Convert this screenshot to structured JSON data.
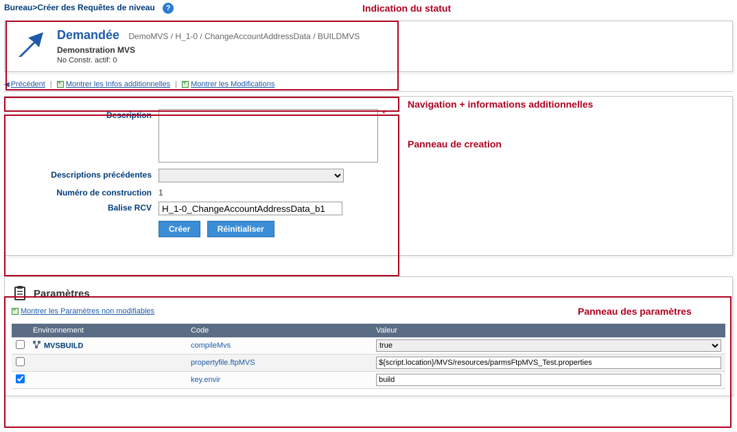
{
  "breadcrumb": {
    "part1": "Bureau",
    "part2": "Créer des Requêtes de niveau"
  },
  "annotations": {
    "status": "Indication du statut",
    "nav": "Navigation + informations additionnelles",
    "creation": "Panneau de creation",
    "params": "Panneau des paramètres"
  },
  "status": {
    "title": "Demandée",
    "path": "DemoMVS / H_1-0 / ChangeAccountAddressData / BUILDMVS",
    "sub": "Demonstration MVS",
    "constr_label": "No Constr. actif:",
    "constr_value": "0"
  },
  "nav": {
    "prev": "Précédent",
    "info": "Montrer les Infos additionnelles",
    "modif": "Montrer les Modifications"
  },
  "form": {
    "desc_label": "Description",
    "prev_label": "Descriptions précédentes",
    "num_label": "Numéro de construction",
    "num_value": "1",
    "rcv_label": "Balise RCV",
    "rcv_value": "H_1-0_ChangeAccountAddressData_b1",
    "btn_create": "Créer",
    "btn_reset": "Réinitialiser"
  },
  "params": {
    "title": "Paramètres",
    "show_link": "Montrer les Paramètres non modifiables",
    "headers": {
      "env": "Environnement",
      "code": "Code",
      "val": "Valeur"
    },
    "rows": [
      {
        "env": "MVSBUILD",
        "code": "compileMvs",
        "val": "true",
        "type": "select",
        "checked": false
      },
      {
        "env": "",
        "code": "propertyfile.ftpMVS",
        "val": "${script.location}/MVS/resources/parmsFtpMVS_Test.properties",
        "type": "text",
        "checked": false
      },
      {
        "env": "",
        "code": "key.envir",
        "val": "build",
        "type": "text",
        "checked": true
      }
    ]
  }
}
